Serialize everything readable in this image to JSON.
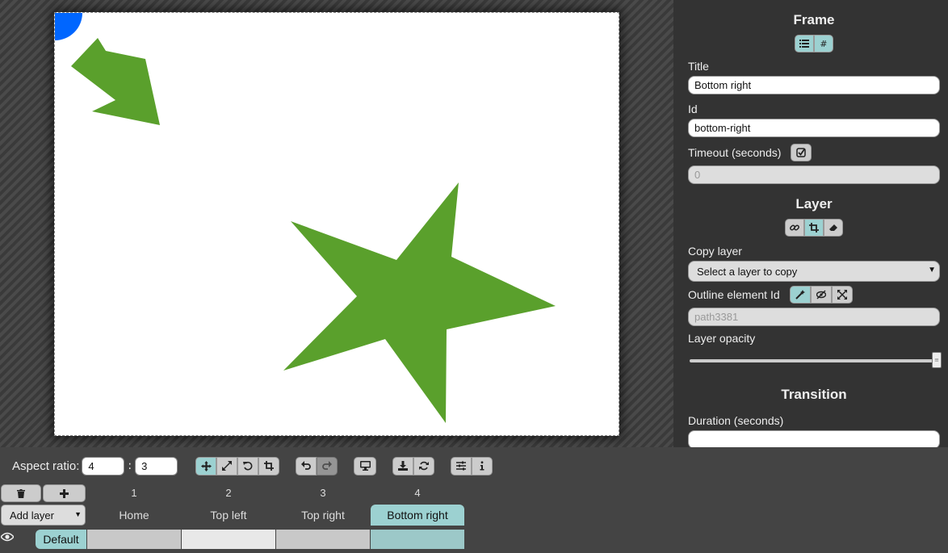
{
  "sidebar": {
    "frame_title": "Frame",
    "title_label": "Title",
    "title_value": "Bottom right",
    "id_label": "Id",
    "id_value": "bottom-right",
    "timeout_label": "Timeout (seconds)",
    "timeout_value": "0",
    "layer_title": "Layer",
    "copy_layer_label": "Copy layer",
    "copy_layer_value": "Select a layer to copy",
    "outline_label": "Outline element Id",
    "outline_value": "path3381",
    "opacity_label": "Layer opacity",
    "opacity_value": 1.0,
    "transition_title": "Transition",
    "duration_label": "Duration (seconds)"
  },
  "toolbar": {
    "aspect_label": "Aspect ratio:",
    "aspect_w": "4",
    "aspect_sep": ":",
    "aspect_h": "3"
  },
  "timeline": {
    "add_layer_label": "Add layer",
    "layer_name": "Default",
    "frames": [
      {
        "number": "1",
        "title": "Home"
      },
      {
        "number": "2",
        "title": "Top left"
      },
      {
        "number": "3",
        "title": "Top right"
      },
      {
        "number": "4",
        "title": "Bottom right"
      }
    ]
  },
  "colors": {
    "accent": "#9cd1d1",
    "shape_green": "#5aa02c",
    "shape_blue": "#0066ff"
  }
}
